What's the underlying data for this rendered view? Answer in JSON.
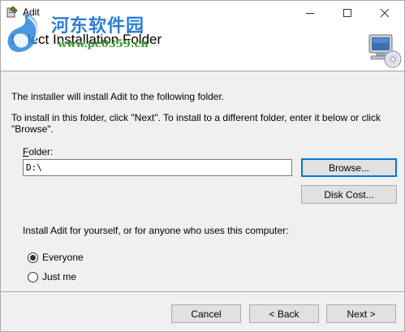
{
  "window": {
    "title": "Adit"
  },
  "banner": {
    "title": "Select Installation Folder"
  },
  "watermark": {
    "name_cn": "河东软件园",
    "url": "www.pc0359.cn"
  },
  "body": {
    "line1": "The installer will install Adit to the following folder.",
    "line2": "To install in this folder, click \"Next\". To install to a different folder, enter it below or click \"Browse\".",
    "folder_label_prefix": "F",
    "folder_label_rest": "older:",
    "folder_value": "D:\\",
    "browse_label": "Browse...",
    "disk_cost_label": "Disk Cost...",
    "install_for_label": "Install Adit for yourself, or for anyone who uses this computer:",
    "radio_options": [
      {
        "label": "Everyone",
        "checked": true
      },
      {
        "label": "Just me",
        "checked": false
      }
    ]
  },
  "footer": {
    "cancel_label": "Cancel",
    "back_label": "< Back",
    "next_label": "Next >"
  },
  "colors": {
    "accent": "#0078d7",
    "watermark_blue": "#2277d0",
    "watermark_green": "#3a9c2b"
  }
}
